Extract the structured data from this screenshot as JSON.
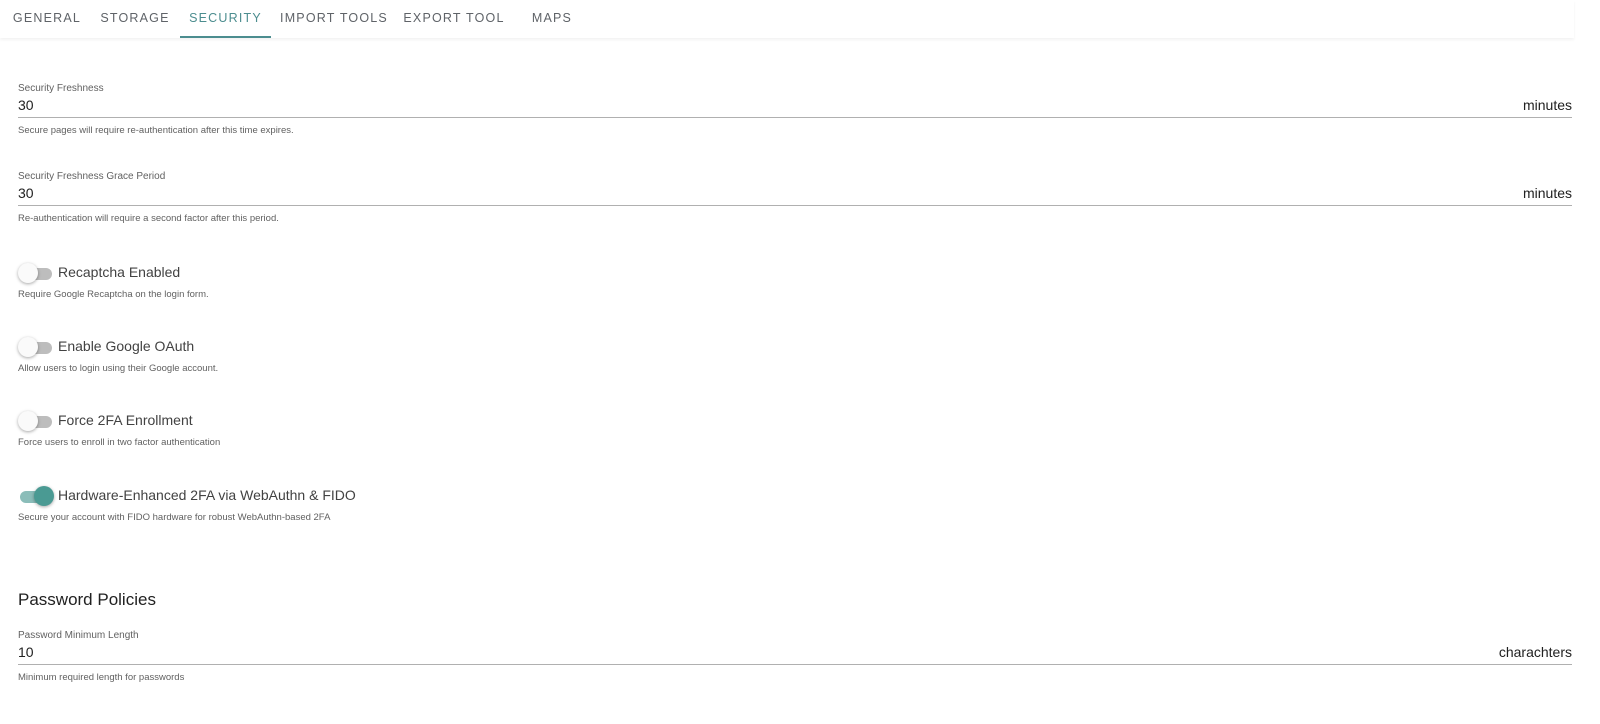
{
  "tabs": [
    {
      "label": "GENERAL"
    },
    {
      "label": "STORAGE"
    },
    {
      "label": "SECURITY",
      "active": true
    },
    {
      "label": "IMPORT TOOLS"
    },
    {
      "label": "EXPORT TOOL"
    },
    {
      "label": "MAPS"
    }
  ],
  "security_freshness": {
    "label": "Security Freshness",
    "value": "30",
    "suffix": "minutes",
    "hint": "Secure pages will require re-authentication after this time expires."
  },
  "grace_period": {
    "label": "Security Freshness Grace Period",
    "value": "30",
    "suffix": "minutes",
    "hint": "Re-authentication will require a second factor after this period."
  },
  "toggles": [
    {
      "label": "Recaptcha Enabled",
      "hint": "Require Google Recaptcha on the login form.",
      "on": false
    },
    {
      "label": "Enable Google OAuth",
      "hint": "Allow users to login using their Google account.",
      "on": false
    },
    {
      "label": "Force 2FA Enrollment",
      "hint": "Force users to enroll in two factor authentication",
      "on": false
    },
    {
      "label": "Hardware-Enhanced 2FA via WebAuthn & FIDO",
      "hint": "Secure your account with FIDO hardware for robust WebAuthn-based 2FA",
      "on": true
    }
  ],
  "password_policies": {
    "title": "Password Policies",
    "min_length": {
      "label": "Password Minimum Length",
      "value": "10",
      "suffix": "charachters",
      "hint": "Minimum required length for passwords"
    }
  },
  "colors": {
    "accent": "#4c8d8f",
    "toggle_on_thumb": "#4a9a93",
    "toggle_on_track": "#8bbdb9",
    "toggle_off_track": "#bdbdbd"
  }
}
